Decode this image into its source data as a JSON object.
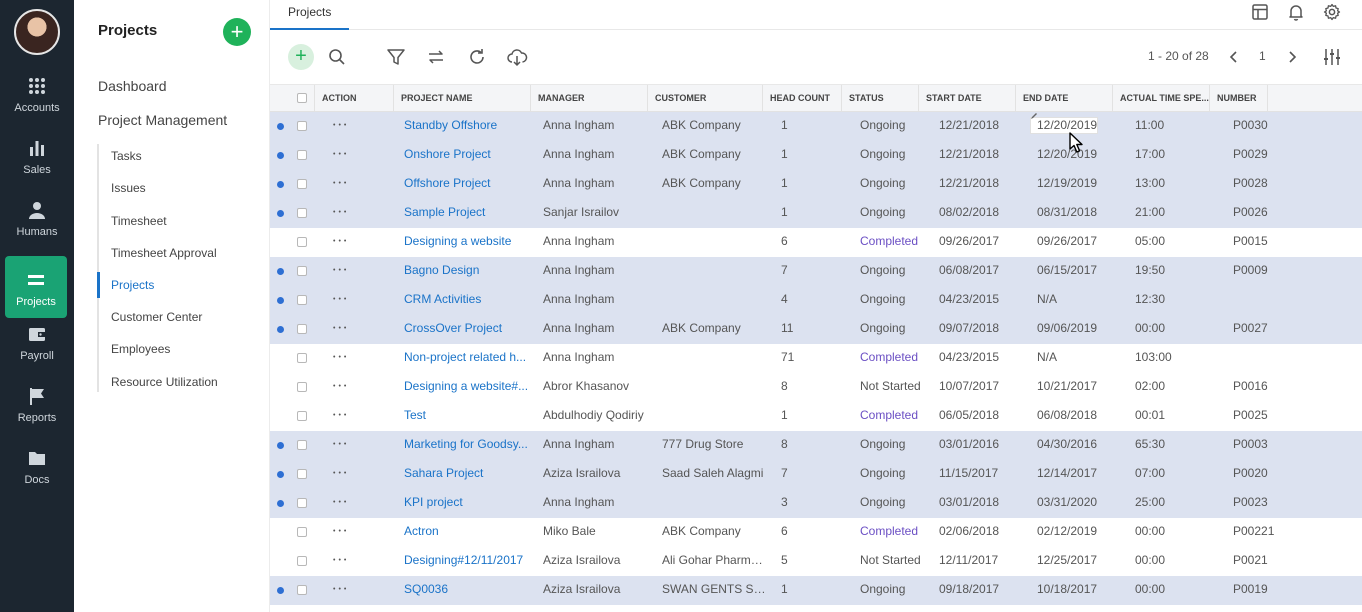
{
  "rail": {
    "items": [
      {
        "label": "Accounts",
        "icon": "grid-icon"
      },
      {
        "label": "Sales",
        "icon": "bar-chart-icon"
      },
      {
        "label": "Humans",
        "icon": "person-icon"
      },
      {
        "label": "Projects",
        "icon": "list-icon",
        "active": true
      },
      {
        "label": "Payroll",
        "icon": "wallet-icon"
      },
      {
        "label": "Reports",
        "icon": "flag-icon"
      },
      {
        "label": "Docs",
        "icon": "folder-icon"
      }
    ]
  },
  "sidebar": {
    "title": "Projects",
    "add_label": "+",
    "top_items": [
      "Dashboard",
      "Project Management"
    ],
    "sub_items": [
      "Tasks",
      "Issues",
      "Timesheet",
      "Timesheet Approval",
      "Projects",
      "Customer Center",
      "Employees",
      "Resource Utilization"
    ],
    "active_sub": "Projects"
  },
  "tabbar": {
    "tab": "Projects"
  },
  "toolbar": {
    "add_label": "+",
    "pager_text": "1 - 20 of 28",
    "page_number": "1"
  },
  "table": {
    "columns": [
      "ACTION",
      "PROJECT NAME",
      "MANAGER",
      "CUSTOMER",
      "HEAD COUNT",
      "STATUS",
      "START DATE",
      "END DATE",
      "ACTUAL TIME SPE...",
      "NUMBER"
    ],
    "rows": [
      {
        "hl": true,
        "name": "Standby Offshore",
        "manager": "Anna Ingham",
        "customer": "ABK Company",
        "head": "1",
        "status": "Ongoing",
        "start": "12/21/2018",
        "end": "12/20/2019",
        "time": "11:00",
        "number": "P0030",
        "editing": true
      },
      {
        "hl": true,
        "name": "Onshore Project",
        "manager": "Anna Ingham",
        "customer": "ABK Company",
        "head": "1",
        "status": "Ongoing",
        "start": "12/21/2018",
        "end": "12/20/2019",
        "time": "17:00",
        "number": "P0029"
      },
      {
        "hl": true,
        "name": "Offshore Project",
        "manager": "Anna Ingham",
        "customer": "ABK Company",
        "head": "1",
        "status": "Ongoing",
        "start": "12/21/2018",
        "end": "12/19/2019",
        "time": "13:00",
        "number": "P0028"
      },
      {
        "hl": true,
        "name": "Sample Project",
        "manager": "Sanjar Israilov",
        "customer": "",
        "head": "1",
        "status": "Ongoing",
        "start": "08/02/2018",
        "end": "08/31/2018",
        "time": "21:00",
        "number": "P0026"
      },
      {
        "hl": false,
        "name": "Designing a website",
        "manager": "Anna Ingham",
        "customer": "",
        "head": "6",
        "status": "Completed",
        "start": "09/26/2017",
        "end": "09/26/2017",
        "time": "05:00",
        "number": "P0015"
      },
      {
        "hl": true,
        "name": "Bagno Design",
        "manager": "Anna Ingham",
        "customer": "",
        "head": "7",
        "status": "Ongoing",
        "start": "06/08/2017",
        "end": "06/15/2017",
        "time": "19:50",
        "number": "P0009"
      },
      {
        "hl": true,
        "name": "CRM Activities",
        "manager": "Anna Ingham",
        "customer": "",
        "head": "4",
        "status": "Ongoing",
        "start": "04/23/2015",
        "end": "N/A",
        "time": "12:30",
        "number": ""
      },
      {
        "hl": true,
        "name": "CrossOver Project",
        "manager": "Anna Ingham",
        "customer": "ABK Company",
        "head": "11",
        "status": "Ongoing",
        "start": "09/07/2018",
        "end": "09/06/2019",
        "time": "00:00",
        "number": "P0027"
      },
      {
        "hl": false,
        "name": "Non-project related h...",
        "manager": "Anna Ingham",
        "customer": "",
        "head": "71",
        "status": "Completed",
        "start": "04/23/2015",
        "end": "N/A",
        "time": "103:00",
        "number": ""
      },
      {
        "hl": false,
        "name": "Designing a website#...",
        "manager": "Abror Khasanov",
        "customer": "",
        "head": "8",
        "status": "Not Started",
        "start": "10/07/2017",
        "end": "10/21/2017",
        "time": "02:00",
        "number": "P0016"
      },
      {
        "hl": false,
        "name": "Test",
        "manager": "Abdulhodiy Qodiriy",
        "customer": "",
        "head": "1",
        "status": "Completed",
        "start": "06/05/2018",
        "end": "06/08/2018",
        "time": "00:01",
        "number": "P0025"
      },
      {
        "hl": true,
        "name": "Marketing for Goodsy...",
        "manager": "Anna Ingham",
        "customer": "777 Drug Store",
        "head": "8",
        "status": "Ongoing",
        "start": "03/01/2016",
        "end": "04/30/2016",
        "time": "65:30",
        "number": "P0003"
      },
      {
        "hl": true,
        "name": "Sahara Project",
        "manager": "Aziza Israilova",
        "customer": "Saad Saleh Alagmi",
        "head": "7",
        "status": "Ongoing",
        "start": "11/15/2017",
        "end": "12/14/2017",
        "time": "07:00",
        "number": "P0020"
      },
      {
        "hl": true,
        "name": "KPI project",
        "manager": "Anna Ingham",
        "customer": "",
        "head": "3",
        "status": "Ongoing",
        "start": "03/01/2018",
        "end": "03/31/2020",
        "time": "25:00",
        "number": "P0023"
      },
      {
        "hl": false,
        "name": "Actron",
        "manager": "Miko Bale",
        "customer": "ABK Company",
        "head": "6",
        "status": "Completed",
        "start": "02/06/2018",
        "end": "02/12/2019",
        "time": "00:00",
        "number": "P00221"
      },
      {
        "hl": false,
        "name": "Designing#12/11/2017",
        "manager": "Aziza Israilova",
        "customer": "Ali Gohar Pharma...",
        "head": "5",
        "status": "Not Started",
        "start": "12/11/2017",
        "end": "12/25/2017",
        "time": "00:00",
        "number": "P0021"
      },
      {
        "hl": true,
        "name": "SQ0036",
        "manager": "Aziza Israilova",
        "customer": "SWAN GENTS SP...",
        "head": "1",
        "status": "Ongoing",
        "start": "09/18/2017",
        "end": "10/18/2017",
        "time": "00:00",
        "number": "P0019"
      }
    ]
  }
}
